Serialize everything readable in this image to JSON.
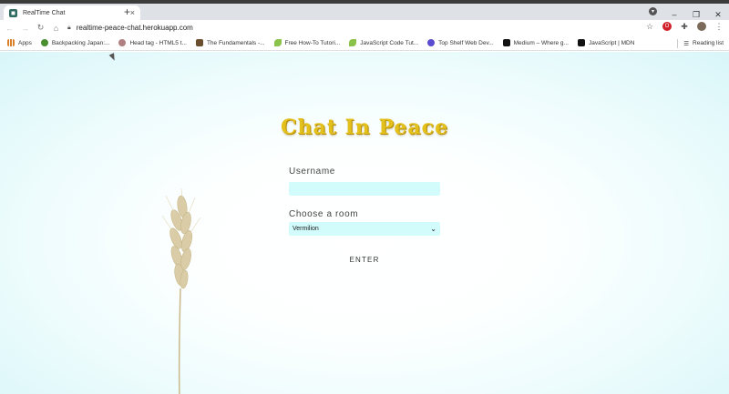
{
  "browser": {
    "tab_title": "RealTime Chat",
    "tab_close": "×",
    "new_tab": "+",
    "url": "realtime-peace-chat.herokuapp.com",
    "window_controls": [
      "–",
      "❐",
      "✕"
    ]
  },
  "bookmarks": {
    "items": [
      {
        "label": "Apps",
        "icon_color": "#d9822b"
      },
      {
        "label": "Backpacking Japan:...",
        "icon_color": "#4a8f2f"
      },
      {
        "label": "Head tag - HTML5 t...",
        "icon_color": "#b08080"
      },
      {
        "label": "The Fundamentals -...",
        "icon_color": "#6b4e2e"
      },
      {
        "label": "Free How-To Tutori...",
        "icon_color": "#8bc34a"
      },
      {
        "label": "JavaScript Code Tut...",
        "icon_color": "#8bc34a"
      },
      {
        "label": "Top Shelf Web Dev...",
        "icon_color": "#5a4bd1"
      },
      {
        "label": "Medium – Where g...",
        "icon_color": "#111111"
      },
      {
        "label": "JavaScript | MDN",
        "icon_color": "#111111"
      }
    ],
    "reading_list": "Reading list"
  },
  "page": {
    "title": "Chat In Peace",
    "username_label": "Username",
    "username_value": "",
    "room_label": "Choose a room",
    "room_selected": "Vermilion",
    "enter_label": "ENTER"
  },
  "colors": {
    "title_gold": "#e4c01c",
    "field_bg": "#d2fbfb",
    "page_tint": "#d9f6f9"
  }
}
